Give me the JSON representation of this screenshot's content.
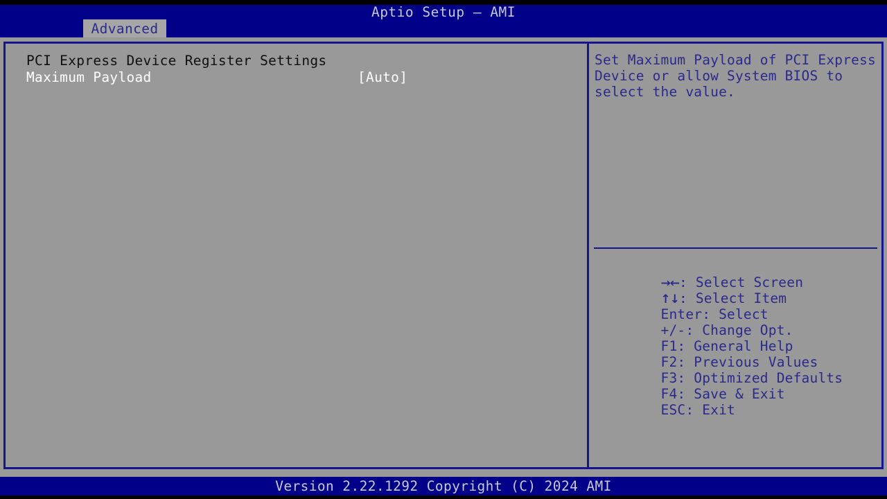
{
  "window": {
    "title": "Aptio Setup – AMI",
    "background_color": "#999999",
    "accent_color": "#000089",
    "border_color": "#151590"
  },
  "menubar": {
    "active_tab": "Advanced",
    "tabs": [
      "Advanced"
    ]
  },
  "main": {
    "section_header": "PCI Express Device Register Settings",
    "options": [
      {
        "label": "Maximum Payload",
        "value": "[Auto]",
        "selected": true
      }
    ]
  },
  "help": {
    "text": "Set Maximum Payload of PCI Express Device or allow System BIOS to select the value.",
    "keys": [
      {
        "icon": "arrow-right-left-icon",
        "glyph": "→←",
        "label": ": Select Screen"
      },
      {
        "icon": "arrow-up-down-icon",
        "glyph": "↑↓",
        "label": ": Select Item"
      },
      {
        "icon": "enter-key-icon",
        "glyph": "",
        "label": "Enter: Select"
      },
      {
        "icon": "plus-minus-key-icon",
        "glyph": "",
        "label": "+/-: Change Opt."
      },
      {
        "icon": "f1-key-icon",
        "glyph": "",
        "label": "F1: General Help"
      },
      {
        "icon": "f2-key-icon",
        "glyph": "",
        "label": "F2: Previous Values"
      },
      {
        "icon": "f3-key-icon",
        "glyph": "",
        "label": "F3: Optimized Defaults"
      },
      {
        "icon": "f4-key-icon",
        "glyph": "",
        "label": "F4: Save & Exit"
      },
      {
        "icon": "esc-key-icon",
        "glyph": "",
        "label": "ESC: Exit"
      }
    ]
  },
  "footer": {
    "version_text": "Version 2.22.1292 Copyright (C) 2024 AMI"
  }
}
